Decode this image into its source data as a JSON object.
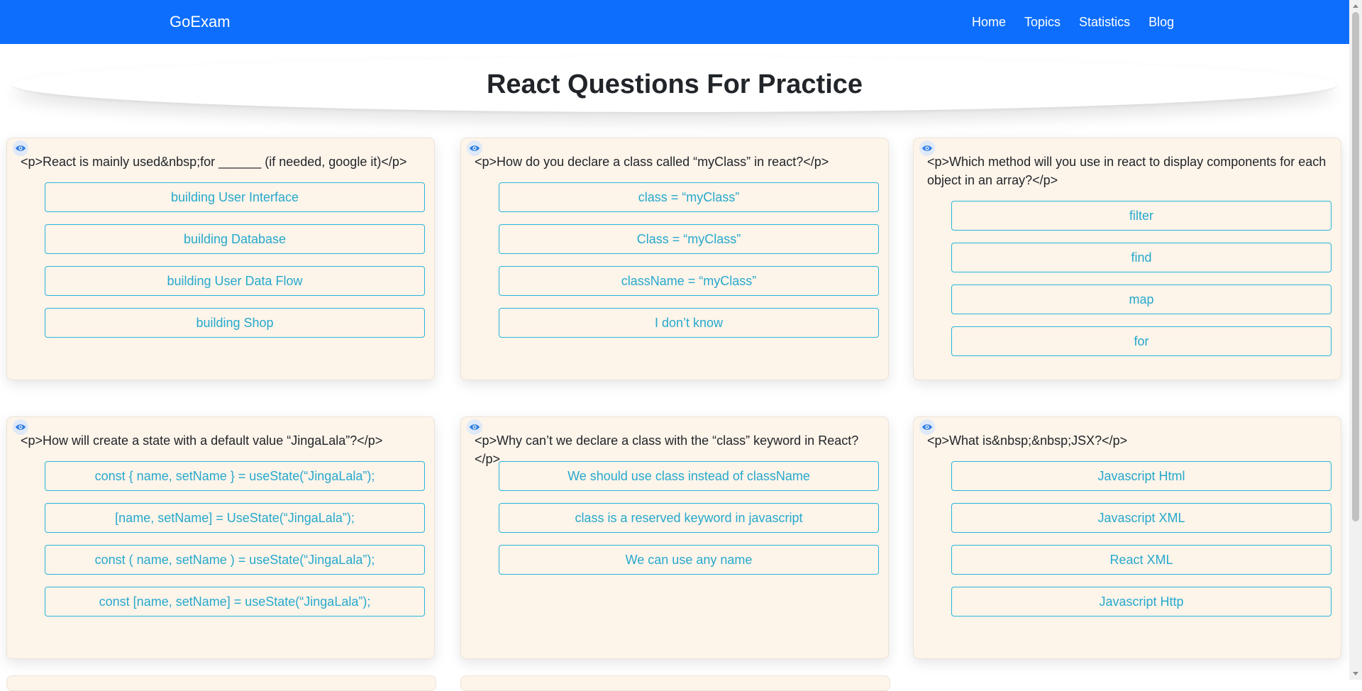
{
  "navbar": {
    "brand": "GoExam",
    "links": [
      "Home",
      "Topics",
      "Statistics",
      "Blog"
    ]
  },
  "page_title": "React Questions For Practice",
  "colors": {
    "navbar": "#0d6efd",
    "card_bg": "#fdf4ea",
    "option_border": "#29b6d8",
    "option_text": "#26a9cc",
    "eye_icon": "#2f7de1"
  },
  "icons": {
    "reveal": "eye-icon"
  },
  "questions": [
    {
      "text": "<p>React is mainly used&nbsp;for ______ (if needed, google it)</p>",
      "options": [
        "building User Interface",
        "building Database",
        "building User Data Flow",
        "building Shop"
      ]
    },
    {
      "text": "<p>How do you declare a class called “myClass” in react?</p>",
      "options": [
        "class = “myClass”",
        "Class = “myClass”",
        "className = “myClass”",
        "I don’t know"
      ]
    },
    {
      "text": "<p>Which method will you use in react to display components for each object in an array?</p>",
      "options": [
        "filter",
        "find",
        "map",
        "for"
      ]
    },
    {
      "text": "<p>How will create a state with a default value “JingaLala”?</p>",
      "options": [
        "const { name, setName } = useState(“JingaLala”);",
        "[name, setName] = UseState(“JingaLala”);",
        "const ( name, setName ) = useState(“JingaLala”);",
        "const [name, setName] = useState(“JingaLala”);"
      ]
    },
    {
      "text": "<p>Why can’t we declare a class with the “class” keyword in React?</p>",
      "options": [
        "We should use class instead of className",
        "class is a reserved keyword in javascript",
        "We can use any name"
      ]
    },
    {
      "text": "<p>What is&nbsp;&nbsp;JSX?</p>",
      "options": [
        "Javascript Html",
        "Javascript XML",
        "React XML",
        "Javascript Http"
      ]
    }
  ]
}
